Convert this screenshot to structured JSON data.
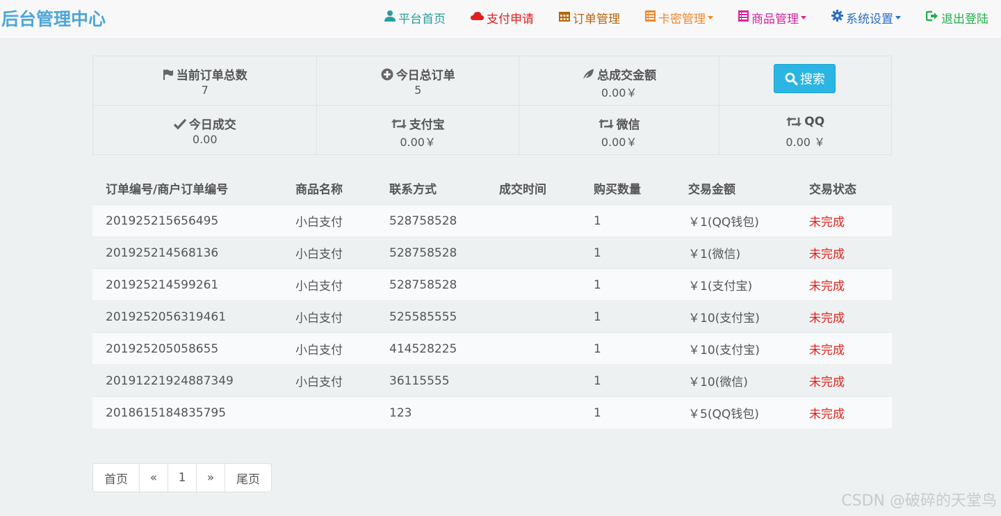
{
  "brand": "后台管理中心",
  "nav": {
    "items": [
      {
        "label": "平台首页",
        "icon": "user-icon",
        "color": "#2a9d9f",
        "dropdown": false
      },
      {
        "label": "支付申请",
        "icon": "cloud-icon",
        "color": "#e02020",
        "dropdown": false
      },
      {
        "label": "订单管理",
        "icon": "calendar-icon",
        "color": "#b5650d",
        "dropdown": false
      },
      {
        "label": "卡密管理",
        "icon": "list-icon",
        "color": "#f0882e",
        "dropdown": true
      },
      {
        "label": "商品管理",
        "icon": "list-icon",
        "color": "#d6249f",
        "dropdown": true
      },
      {
        "label": "系统设置",
        "icon": "gear-icon",
        "color": "#2a6fc2",
        "dropdown": true
      },
      {
        "label": "退出登陆",
        "icon": "logout-icon",
        "color": "#22b04a",
        "dropdown": false
      }
    ]
  },
  "stats": {
    "total_orders": {
      "label": "当前订单总数",
      "value": "7",
      "icon": "flag-icon"
    },
    "today_orders": {
      "label": "今日总订单",
      "value": "5",
      "icon": "plus-circle-icon"
    },
    "total_amount": {
      "label": "总成交金额",
      "value": "0.00￥",
      "icon": "leaf-icon"
    },
    "search_label": "搜索",
    "today_deals": {
      "label": "今日成交",
      "value": "0.00",
      "icon": "check-icon"
    },
    "alipay": {
      "label": "支付宝",
      "value": "0.00￥",
      "icon": "retweet-icon"
    },
    "wechat": {
      "label": "微信",
      "value": "0.00￥",
      "icon": "retweet-icon"
    },
    "qq": {
      "label": "QQ",
      "value": "0.00 ￥",
      "icon": "retweet-icon"
    }
  },
  "table": {
    "headers": [
      "订单编号/商户订单编号",
      "商品名称",
      "联系方式",
      "成交时间",
      "购买数量",
      "交易金额",
      "交易状态"
    ],
    "rows": [
      {
        "order_id": "201925215656495",
        "product": "小白支付",
        "contact": "528758528",
        "time": "",
        "qty": "1",
        "amount": "￥1(QQ钱包)",
        "status": "未完成"
      },
      {
        "order_id": "201925214568136",
        "product": "小白支付",
        "contact": "528758528",
        "time": "",
        "qty": "1",
        "amount": "￥1(微信)",
        "status": "未完成"
      },
      {
        "order_id": "201925214599261",
        "product": "小白支付",
        "contact": "528758528",
        "time": "",
        "qty": "1",
        "amount": "￥1(支付宝)",
        "status": "未完成"
      },
      {
        "order_id": "2019252056319461",
        "product": "小白支付",
        "contact": "525585555",
        "time": "",
        "qty": "1",
        "amount": "￥10(支付宝)",
        "status": "未完成"
      },
      {
        "order_id": "201925205058655",
        "product": "小白支付",
        "contact": "414528225",
        "time": "",
        "qty": "1",
        "amount": "￥10(支付宝)",
        "status": "未完成"
      },
      {
        "order_id": "20191221924887349",
        "product": "小白支付",
        "contact": "36115555",
        "time": "",
        "qty": "1",
        "amount": "￥10(微信)",
        "status": "未完成"
      },
      {
        "order_id": "2018615184835795",
        "product": "",
        "contact": "123",
        "time": "",
        "qty": "1",
        "amount": "￥5(QQ钱包)",
        "status": "未完成"
      }
    ]
  },
  "pagination": {
    "first": "首页",
    "prev": "«",
    "current": "1",
    "next": "»",
    "last": "尾页"
  },
  "watermark": "CSDN @破碎的天堂鸟",
  "colors": {
    "brand": "#4da6d9",
    "search_button": "#2bb5e3",
    "status_incomplete": "#e0201c"
  }
}
